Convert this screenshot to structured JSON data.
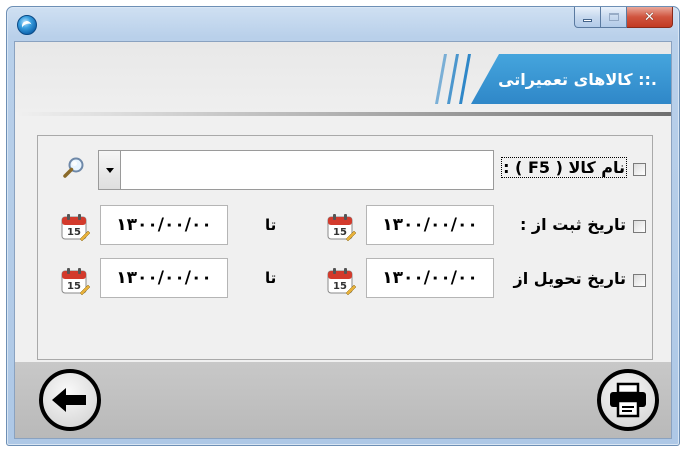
{
  "window": {
    "title": "",
    "buttons": {
      "minimize": "minimize",
      "maximize": "maximize",
      "close": "close"
    },
    "accent": "#3a96d6"
  },
  "header": {
    "title": ".:: کالاهای تعمیراتی"
  },
  "form": {
    "item_name": {
      "label": "نام کالا ( F5 ) :",
      "value": "",
      "checked": false
    },
    "reg_date": {
      "label": "تاریخ ثبت از :",
      "from": "۱۳۰۰/۰۰/۰۰",
      "to_label": "تا",
      "to": "۱۳۰۰/۰۰/۰۰",
      "checked": false
    },
    "delivery_date": {
      "label": "تاریخ تحویل از",
      "from": "۱۳۰۰/۰۰/۰۰",
      "to_label": "تا",
      "to": "۱۳۰۰/۰۰/۰۰",
      "checked": false
    },
    "calendar_day": "15"
  },
  "icons": {
    "search": "magnifier-icon",
    "calendar": "calendar-icon",
    "back": "back-arrow-icon",
    "print": "printer-icon"
  }
}
